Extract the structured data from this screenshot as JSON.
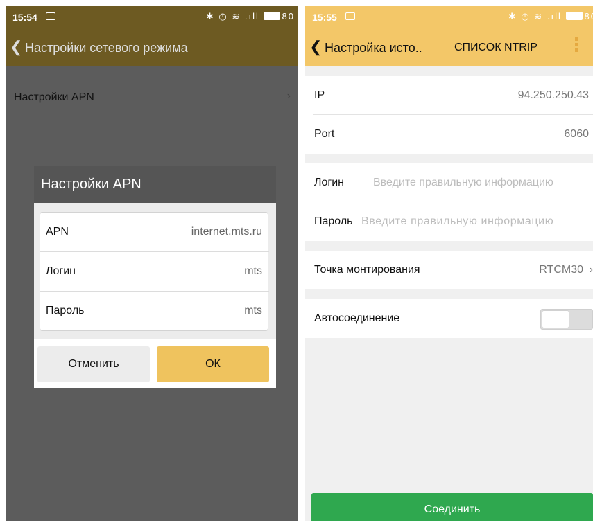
{
  "left": {
    "status": {
      "time": "15:54",
      "battery": "80"
    },
    "appbar": {
      "title": "Настройки сетевого режима"
    },
    "list": {
      "apn_label": "Настройки APN"
    },
    "dialog": {
      "title": "Настройки APN",
      "fields": [
        {
          "label": "APN",
          "value": "internet.mts.ru"
        },
        {
          "label": "Логин",
          "value": "mts"
        },
        {
          "label": "Пароль",
          "value": "mts"
        }
      ],
      "cancel_label": "Отменить",
      "ok_label": "ОК"
    }
  },
  "right": {
    "status": {
      "time": "15:55",
      "battery": "80"
    },
    "appbar": {
      "title": "Настройка исто..",
      "tab": "СПИСОК NTRIP"
    },
    "ip": {
      "label": "IP",
      "value": "94.250.250.43"
    },
    "port": {
      "label": "Port",
      "value": "6060"
    },
    "login": {
      "label": "Логин",
      "placeholder": "Введите правильную информацию"
    },
    "password": {
      "label": "Пароль",
      "placeholder": "Введите правильную информацию"
    },
    "mount": {
      "label": "Точка монтирования",
      "value": "RTCM30"
    },
    "auto": {
      "label": "Автосоединение",
      "enabled": false
    },
    "connect_label": "Соединить"
  },
  "colors": {
    "accent": "#f3c768",
    "accent_dimmed": "#6d5a22",
    "connect_button": "#2fa84f",
    "ok_button": "#efc35e"
  },
  "icons": [
    "image-icon",
    "bluetooth-icon",
    "alarm-icon",
    "wifi-icon",
    "signal-icon",
    "battery-icon",
    "back-chevron-icon",
    "chevron-right-icon",
    "kebab-menu-icon"
  ]
}
